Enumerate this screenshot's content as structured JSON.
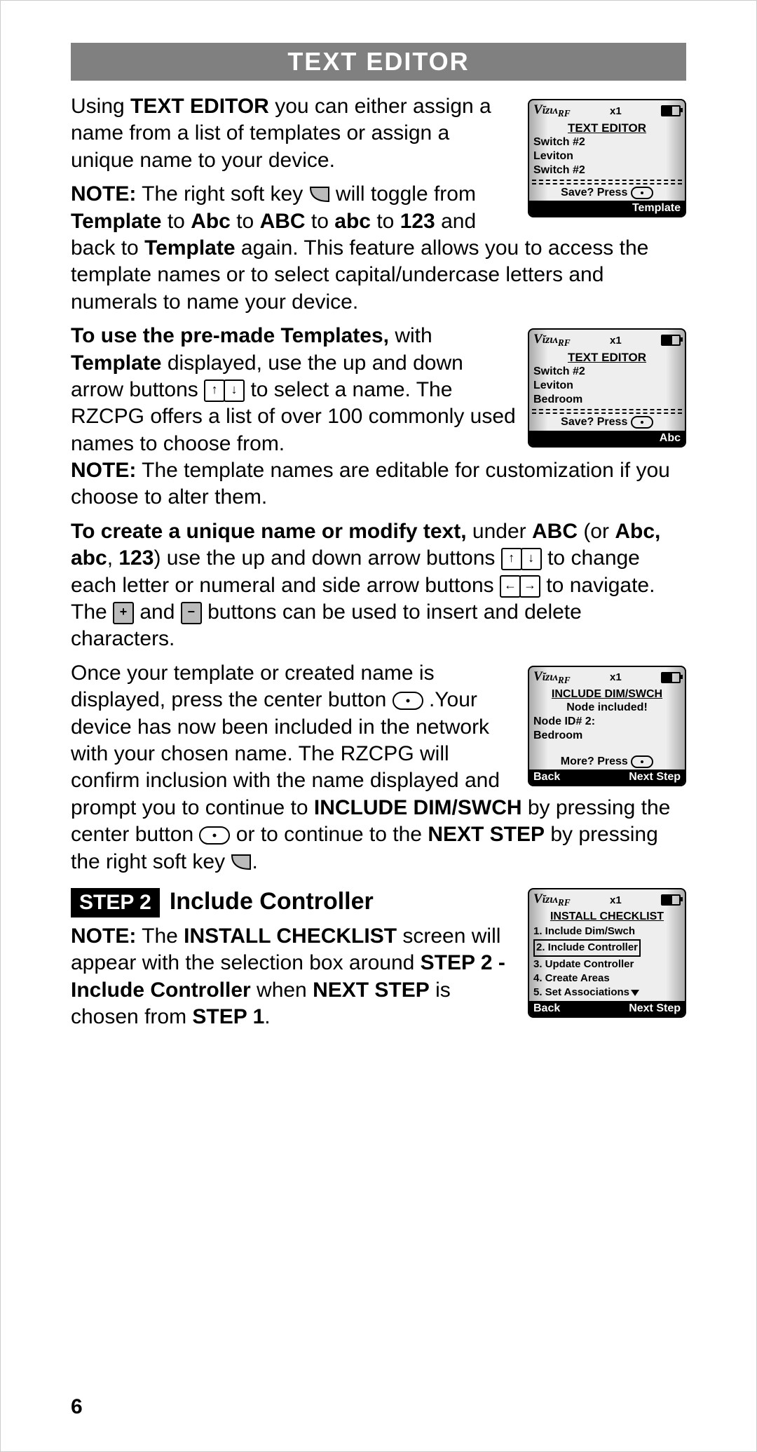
{
  "header": "TEXT EDITOR",
  "pageNumber": "6",
  "step2": {
    "chip": "STEP 2",
    "title": "Include Controller"
  },
  "screens": {
    "s1": {
      "sig": "x1",
      "title": "TEXT EDITOR",
      "line1": "Switch #2",
      "line2": "Leviton",
      "line3": "Switch #2",
      "save": "Save? Press",
      "foot_right": "Template"
    },
    "s2": {
      "sig": "x1",
      "title": "TEXT EDITOR",
      "line1": "Switch #2",
      "line2": "Leviton",
      "line3": "Bedroom",
      "save": "Save? Press",
      "foot_right": "Abc"
    },
    "s3": {
      "sig": "x1",
      "title": "INCLUDE DIM/SWCH",
      "line1": "Node included!",
      "line2": "Node ID# 2:",
      "line3": "Bedroom",
      "save": "More? Press",
      "foot_left": "Back",
      "foot_right": "Next Step"
    },
    "s4": {
      "sig": "x1",
      "title": "INSTALL CHECKLIST",
      "items": [
        "1. Include Dim/Swch",
        "2. Include Controller",
        "3. Update Controller",
        "4. Create Areas",
        "5. Set Associations"
      ],
      "foot_left": "Back",
      "foot_right": "Next Step"
    }
  },
  "txt": {
    "p1a": "Using ",
    "p1b": "TEXT EDITOR",
    "p1c": " you can either assign a name from a list of templates or assign a unique name to your device.",
    "p2a": "NOTE:",
    "p2b": " The right soft key ",
    "p2c": " will toggle from ",
    "p2d": "Template",
    "p2e": " to ",
    "p2f": "Abc",
    "p2g": "ABC",
    "p2h": "abc",
    "p2i": "123",
    "p2j": " and back to ",
    "p2k": " again. This feature allows you to access the template names or to select capital/undercase letters and numerals to name your device.",
    "p3a": "To use the pre-made Templates,",
    "p3b": " with ",
    "p3c": " displayed, use the up and down arrow buttons ",
    "p3d": " to select a name. The RZCPG offers a list of over 100 commonly used names to choose from.",
    "p3e": " The template names are editable for customization if you choose to alter them.",
    "p4a": "To create a unique name or modify text,",
    "p4b": " under ",
    "p4c": " (or ",
    "p4d": "Abc, abc",
    "p4e": ", ",
    "p4f": ") use the up and down arrow buttons ",
    "p4g": " to change each letter or numeral and side arrow buttons ",
    "p4h": " to navigate. The ",
    "p4i": " and ",
    "p4j": " buttons can be used to insert and delete characters.",
    "p5a": "Once your template or created name is displayed, press the center button ",
    "p5b": " .Your device has now been included in the network with your chosen name. The RZCPG will confirm inclusion with the name displayed and prompt you to continue to ",
    "p5c": "INCLUDE DIM/SWCH",
    "p5d": " by pressing the center button ",
    "p5e": " or to continue to the ",
    "p5f": "NEXT STEP",
    "p5g": " by pressing the right soft key ",
    "p6a": " The ",
    "p6b": "INSTALL CHECKLIST",
    "p6c": " screen will appear with the selection box around ",
    "p6d": "STEP 2 - Include Controller",
    "p6e": " when ",
    "p6f": "NEXT STEP",
    "p6g": " is chosen from ",
    "p6h": "STEP 1",
    "period": "."
  }
}
